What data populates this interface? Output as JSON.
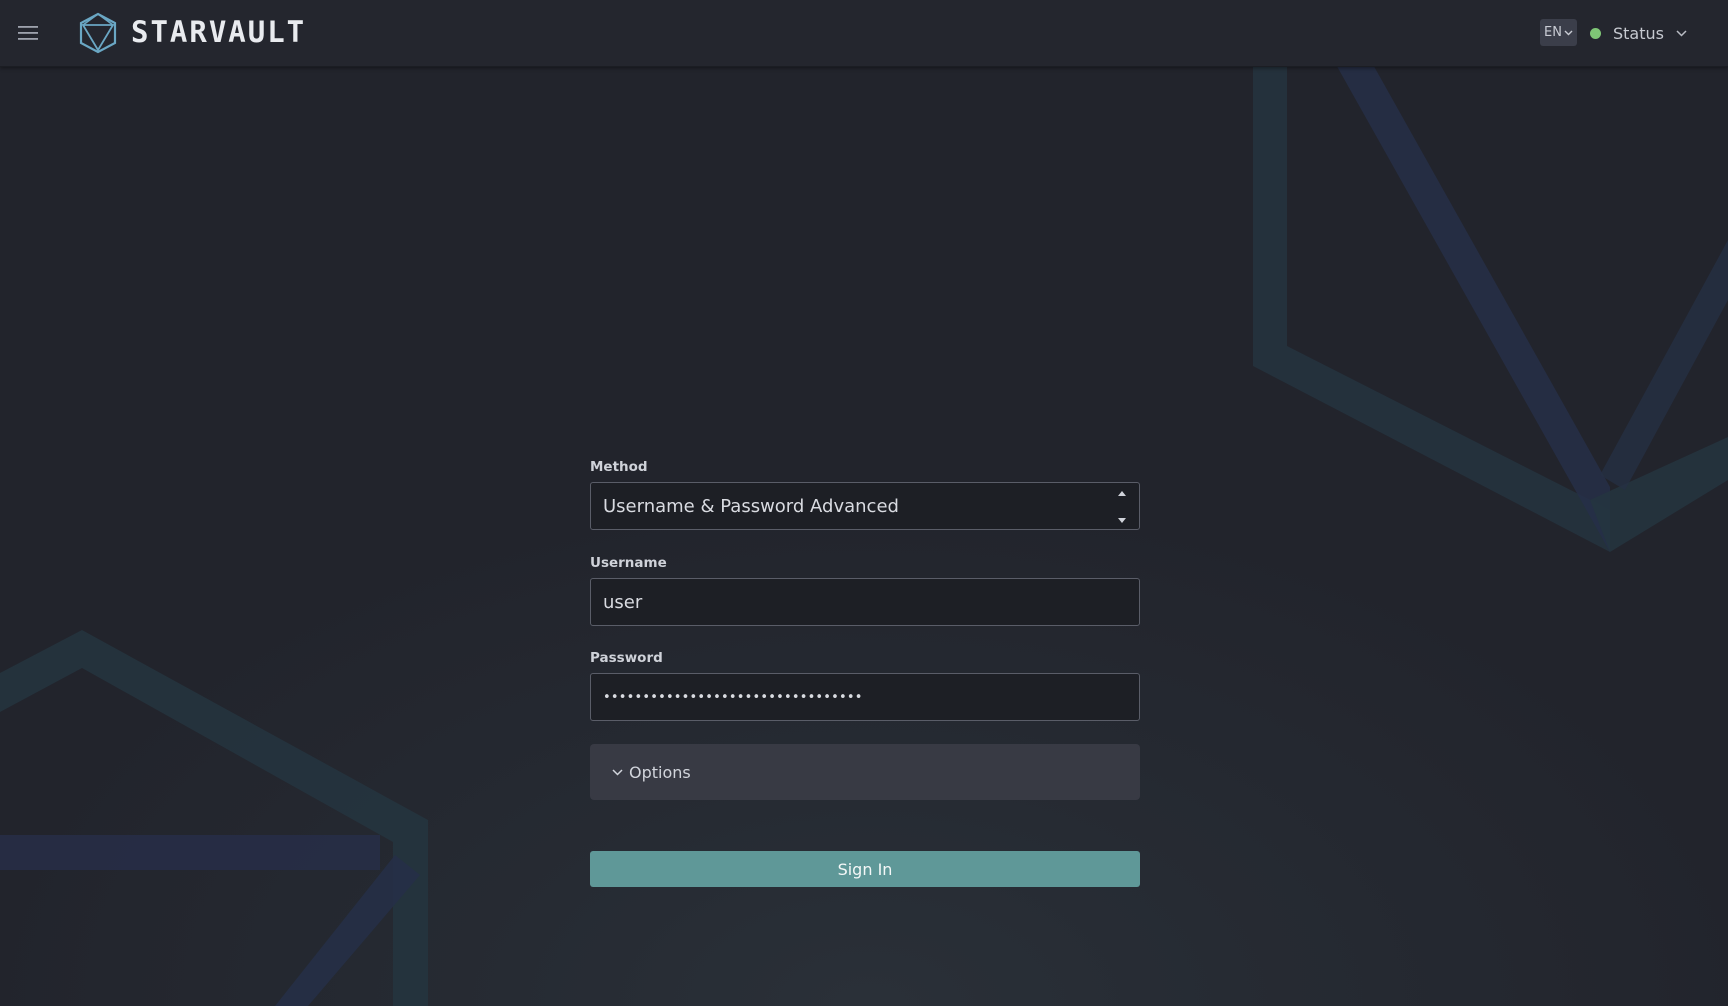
{
  "header": {
    "brand": "STARVAULT",
    "language": "EN",
    "status_label": "Status",
    "status_color": "#7fc676"
  },
  "icons": {
    "menu": "hamburger-menu-icon",
    "logo": "hexagon-logo-icon",
    "lang_chevron": "chevron-down-icon",
    "status_chevron": "chevron-down-icon",
    "select_arrows": "sort-arrows-icon",
    "options_chevron": "chevron-down-icon"
  },
  "form": {
    "method_label": "Method",
    "method_value": "Username & Password Advanced",
    "username_label": "Username",
    "username_value": "user",
    "password_label": "Password",
    "password_masked": "•••••••••••••••••••••••••••••••••",
    "options_label": "Options",
    "signin_label": "Sign In"
  },
  "colors": {
    "accent": "#5f9898",
    "background": "#22242c",
    "header": "#24262e",
    "brand_logo": "#6aa7c4"
  }
}
